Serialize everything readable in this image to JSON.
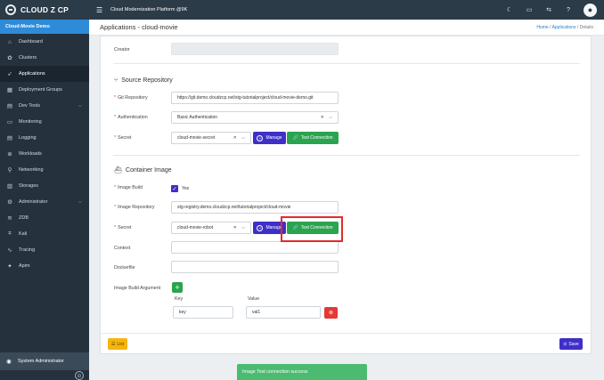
{
  "brand": {
    "name": "CLOUD Z CP"
  },
  "sidebar": {
    "project": "Cloud-Movie Demo",
    "items": [
      {
        "label": "Dashboard",
        "icon": "dashboard-icon",
        "glyph": "⌂"
      },
      {
        "label": "Clusters",
        "icon": "cluster-icon",
        "glyph": "✿"
      },
      {
        "label": "Applications",
        "icon": "rocket-icon",
        "glyph": "➶"
      },
      {
        "label": "Deployment Groups",
        "icon": "grid-icon",
        "glyph": "▦"
      },
      {
        "label": "Dev Tools",
        "icon": "tools-icon",
        "glyph": "▤"
      },
      {
        "label": "Monitoring",
        "icon": "monitor-icon",
        "glyph": "▭"
      },
      {
        "label": "Logging",
        "icon": "log-icon",
        "glyph": "▤"
      },
      {
        "label": "Workloads",
        "icon": "globe-icon",
        "glyph": "⊕"
      },
      {
        "label": "Networking",
        "icon": "network-icon",
        "glyph": "⚲"
      },
      {
        "label": "Storages",
        "icon": "storage-icon",
        "glyph": "▥"
      },
      {
        "label": "Administrator",
        "icon": "gear-icon",
        "glyph": "⚙"
      },
      {
        "label": "ZDB",
        "icon": "database-icon",
        "glyph": "≋"
      },
      {
        "label": "Kali",
        "icon": "scan-icon",
        "glyph": "⌗"
      },
      {
        "label": "Tracing",
        "icon": "tracing-icon",
        "glyph": "∿"
      },
      {
        "label": "Apim",
        "icon": "apim-icon",
        "glyph": "✦"
      }
    ],
    "user": "System Administrator",
    "collapse_glyph": "⊖"
  },
  "topbar": {
    "title": "Cloud Modernization Platform @9K",
    "icons": [
      "moon-icon",
      "monitor-icon",
      "translate-icon",
      "help-icon",
      "user-avatar-icon"
    ]
  },
  "header": {
    "title": "Applications - cloud-movie",
    "breadcrumb": [
      "Home",
      "Applications",
      "Details"
    ]
  },
  "form": {
    "creator_label": "Creator",
    "creator_value": "",
    "source": {
      "title": "Source Repository",
      "git_label": "Git Repository",
      "git_value": "https://git.demo.cloudzcp.net/stg-tutorialproject/cloud-movie-demo.git",
      "auth_label": "Authentication",
      "auth_value": "Basic Authentication",
      "secret_label": "Secret",
      "secret_value": "cloud-movie-secret"
    },
    "container": {
      "title": "Container Image",
      "build_label": "Image Build",
      "build_yes": "Yes",
      "repo_label": "Image Repository",
      "repo_value": "stg-registry.demo.cloudzcp.net/tutorialproject/cloud-movie",
      "secret_label": "Secret",
      "secret_value": "cloud-movie-robot",
      "context_label": "Context",
      "context_value": "",
      "dockerfile_label": "Dockerfile",
      "dockerfile_value": "",
      "arg_label": "Image Build Argument",
      "key_header": "Key",
      "value_header": "Value",
      "arg_key": "key",
      "arg_value": "val1"
    },
    "manage_label": "Manage",
    "test_label": "Test Connection"
  },
  "footer": {
    "list_label": "List",
    "save_label": "Save"
  },
  "toast": {
    "message": "Image Test connection success"
  },
  "colors": {
    "sidebar": "#25313d",
    "primary": "#3f2fc9",
    "success": "#2aa44f",
    "danger": "#e53935",
    "warning": "#f6b40e",
    "link": "#2d7fc8",
    "highlight": "#e32b2b"
  }
}
